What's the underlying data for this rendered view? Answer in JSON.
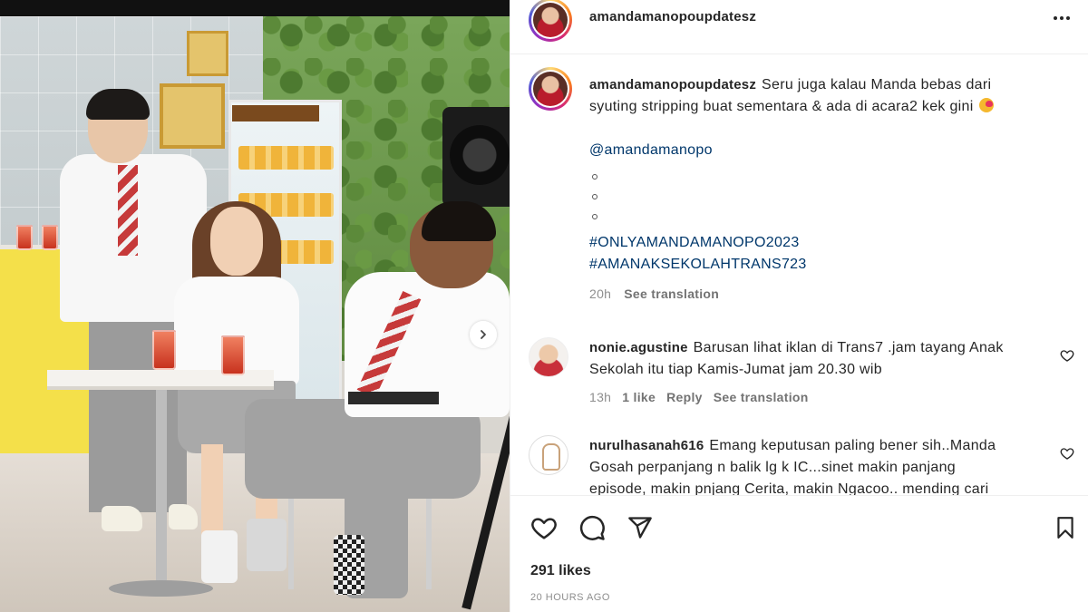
{
  "post": {
    "username": "amandamanopoupdatesz",
    "caption_text": "Seru juga kalau Manda bebas dari",
    "caption_text_line2": "syuting stripping buat sementara & ada di acara2 kek gini",
    "caption_emoji": "smiling-face-with-hearts-emoji",
    "mention": "@amandamanopo",
    "hashtags": [
      "#ONLYAMANDAMANOPO2023",
      "#AMANAKSEKOLAHTRANS723"
    ],
    "caption_time": "20h",
    "see_translation": "See translation"
  },
  "comments": [
    {
      "username": "nonie.agustine",
      "text_line1": "Barusan lihat iklan di Trans7 .jam tayang Anak",
      "text_line2": "Sekolah itu tiap Kamis-Jumat jam 20.30 wib",
      "time": "13h",
      "likes": "1 like",
      "reply": "Reply",
      "see_translation": "See translation"
    },
    {
      "username": "nurulhasanah616",
      "text_line1": "Emang keputusan paling bener sih..Manda",
      "text_line2": "Gosah perpanjang n balik lg k IC...sinet makin panjang",
      "text_line3": "episode, makin pnjang Cerita, makin Ngacoo.. mending cari"
    }
  ],
  "actions": {
    "icons": [
      "heart-icon",
      "comment-icon",
      "share-icon",
      "bookmark-icon"
    ]
  },
  "likes_count": "291 likes",
  "posted_ago": "20 HOURS AGO"
}
